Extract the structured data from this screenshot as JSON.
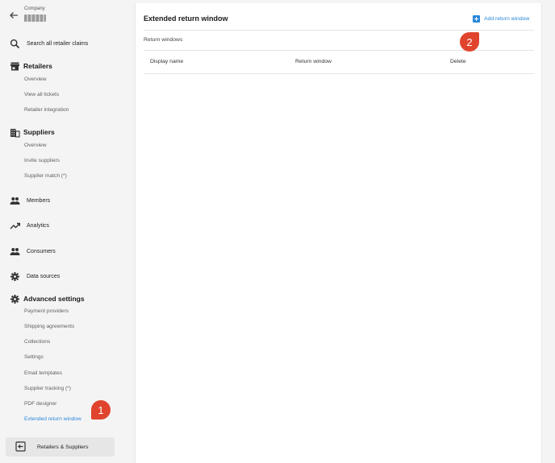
{
  "sidebar": {
    "company_label": "Company",
    "search_label": "Search all retailer claims",
    "retailers": {
      "title": "Retailers",
      "items": [
        "Overview",
        "View all tickets",
        "Retailer integration"
      ]
    },
    "suppliers": {
      "title": "Suppliers",
      "items": [
        "Overview",
        "Invite suppliers",
        "Supplier match (*)"
      ]
    },
    "members": "Members",
    "analytics": "Analytics",
    "consumers": "Consumers",
    "data_sources": "Data sources",
    "advanced": {
      "title": "Advanced settings",
      "items": [
        "Payment providers",
        "Shipping agreements",
        "Collections",
        "Settings",
        "Email templates",
        "Supplier tracking (*)",
        "PDF designer",
        "Extended return window"
      ],
      "active_index": 7
    },
    "bottom_button": "Retailers & Suppliers"
  },
  "main": {
    "title": "Extended return window",
    "add_button": "Add return window",
    "section_label": "Return windows",
    "columns": [
      "Display name",
      "Return window",
      "Delete"
    ]
  },
  "markers": [
    "1",
    "2"
  ],
  "colors": {
    "accent": "#2a87d8",
    "marker": "#e0442d",
    "sidebar_bg": "#f4f4f5"
  }
}
